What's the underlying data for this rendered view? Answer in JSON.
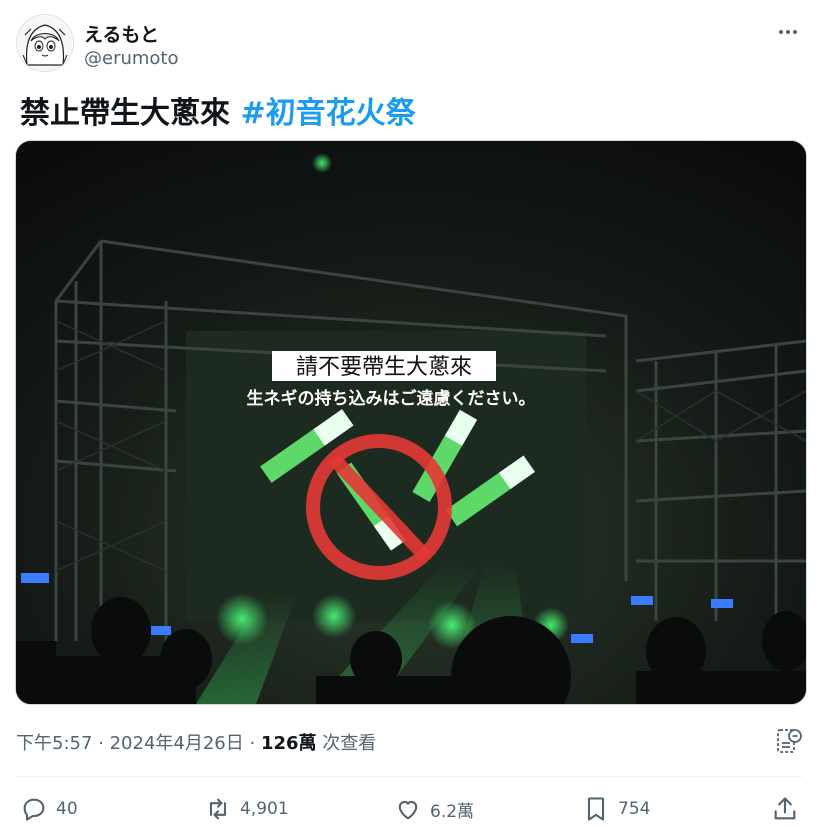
{
  "author": {
    "display_name": "えるもと",
    "handle": "@erumoto",
    "avatar_icon": "anime-girl-avatar"
  },
  "more_icon": "more-horizontal-icon",
  "tweet": {
    "text": "禁止帶生大蔥來",
    "hashtag": "#初音花火祭"
  },
  "media": {
    "caption_zh": "請不要帶生大蔥來",
    "caption_ja": "生ネギの持ち込みはご遠慮ください。"
  },
  "meta": {
    "time": "下午5:57",
    "separator1": " · ",
    "date": "2024年4月26日",
    "separator2": " · ",
    "views_count": "126萬",
    "views_label": " 次查看"
  },
  "actions": {
    "replies": "40",
    "reposts": "4,901",
    "likes": "6.2萬",
    "bookmarks": "754"
  },
  "colors": {
    "hashtag": "#1d9bf0",
    "secondary_text": "#536471",
    "laser_green": "#3ee86a"
  }
}
